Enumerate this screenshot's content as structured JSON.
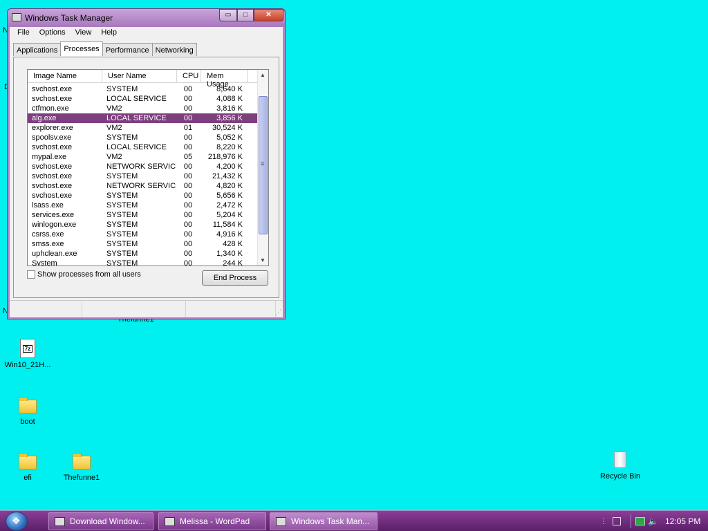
{
  "window": {
    "title": "Windows Task Manager",
    "controls": {
      "minimize": "▭",
      "maximize": "□",
      "close": "✕"
    }
  },
  "menu": [
    "File",
    "Options",
    "View",
    "Help"
  ],
  "tabs": [
    {
      "label": "Applications",
      "active": false
    },
    {
      "label": "Processes",
      "active": true
    },
    {
      "label": "Performance",
      "active": false
    },
    {
      "label": "Networking",
      "active": false
    }
  ],
  "processes": {
    "columns": [
      "Image Name",
      "User Name",
      "CPU",
      "Mem Usage"
    ],
    "rows": [
      {
        "name": "svchost.exe",
        "user": "SYSTEM",
        "cpu": "00",
        "mem": "8,640 K"
      },
      {
        "name": "svchost.exe",
        "user": "LOCAL SERVICE",
        "cpu": "00",
        "mem": "4,088 K"
      },
      {
        "name": "ctfmon.exe",
        "user": "VM2",
        "cpu": "00",
        "mem": "3,816 K"
      },
      {
        "name": "alg.exe",
        "user": "LOCAL SERVICE",
        "cpu": "00",
        "mem": "3,856 K",
        "selected": true
      },
      {
        "name": "explorer.exe",
        "user": "VM2",
        "cpu": "01",
        "mem": "30,524 K"
      },
      {
        "name": "spoolsv.exe",
        "user": "SYSTEM",
        "cpu": "00",
        "mem": "5,052 K"
      },
      {
        "name": "svchost.exe",
        "user": "LOCAL SERVICE",
        "cpu": "00",
        "mem": "8,220 K"
      },
      {
        "name": "mypal.exe",
        "user": "VM2",
        "cpu": "05",
        "mem": "218,976 K"
      },
      {
        "name": "svchost.exe",
        "user": "NETWORK SERVICE",
        "cpu": "00",
        "mem": "4,200 K"
      },
      {
        "name": "svchost.exe",
        "user": "SYSTEM",
        "cpu": "00",
        "mem": "21,432 K"
      },
      {
        "name": "svchost.exe",
        "user": "NETWORK SERVICE",
        "cpu": "00",
        "mem": "4,820 K"
      },
      {
        "name": "svchost.exe",
        "user": "SYSTEM",
        "cpu": "00",
        "mem": "5,656 K"
      },
      {
        "name": "lsass.exe",
        "user": "SYSTEM",
        "cpu": "00",
        "mem": "2,472 K"
      },
      {
        "name": "services.exe",
        "user": "SYSTEM",
        "cpu": "00",
        "mem": "5,204 K"
      },
      {
        "name": "winlogon.exe",
        "user": "SYSTEM",
        "cpu": "00",
        "mem": "11,584 K"
      },
      {
        "name": "csrss.exe",
        "user": "SYSTEM",
        "cpu": "00",
        "mem": "4,916 K"
      },
      {
        "name": "smss.exe",
        "user": "SYSTEM",
        "cpu": "00",
        "mem": "428 K"
      },
      {
        "name": "uphclean.exe",
        "user": "SYSTEM",
        "cpu": "00",
        "mem": "1,340 K"
      },
      {
        "name": "System",
        "user": "SYSTEM",
        "cpu": "00",
        "mem": "244 K"
      }
    ]
  },
  "show_all_users_label": "Show processes from all users",
  "show_all_users_checked": false,
  "end_process_label": "End Process",
  "desktop_icons": [
    {
      "label": "Win10_21H...",
      "icon": "7z-archive-icon"
    },
    {
      "label": "boot",
      "icon": "folder-icon"
    },
    {
      "label": "efi",
      "icon": "folder-icon"
    },
    {
      "label": "Thefunne1",
      "icon": "folder-icon"
    },
    {
      "label": "Recycle Bin",
      "icon": "recycle-bin-icon"
    }
  ],
  "desktop_fragments": {
    "thefunne1_behind": "Thefunne1",
    "left_n1": "N",
    "left_d": "D",
    "left_n2": "N"
  },
  "taskbar": {
    "buttons": [
      {
        "label": "Download Window...",
        "active": false
      },
      {
        "label": "Melissa - WordPad",
        "active": false
      },
      {
        "label": "Windows Task Man...",
        "active": true
      }
    ],
    "clock": "12:05 PM"
  },
  "colors": {
    "desktop": "#00f0f0",
    "selection": "#7e3f7e",
    "taskbar": "#6b2a7a"
  }
}
